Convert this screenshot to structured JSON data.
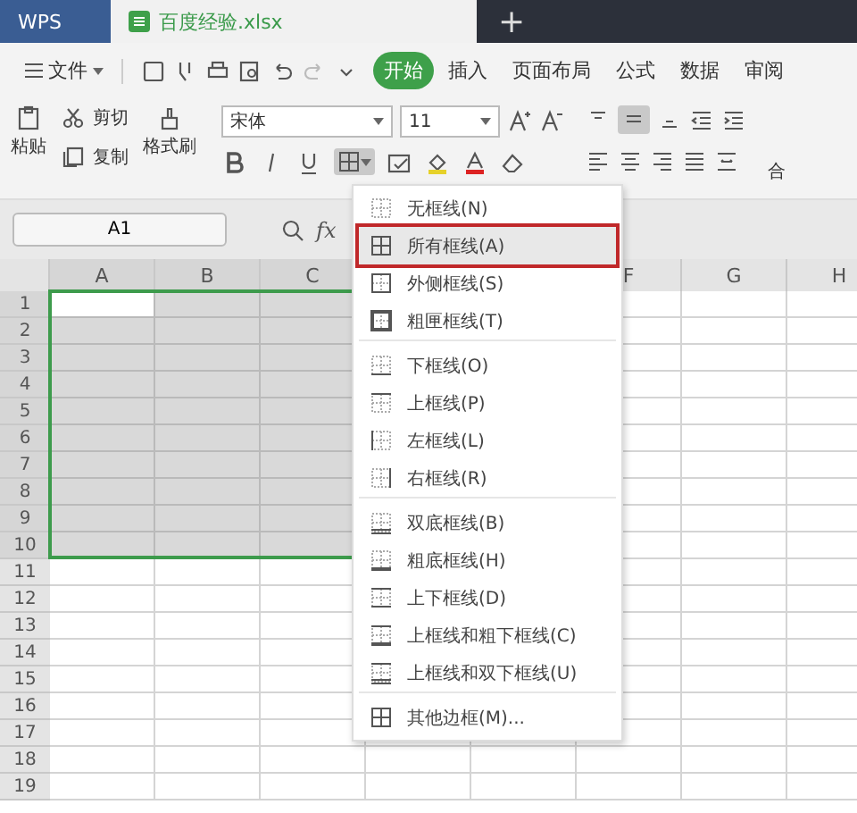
{
  "title_tabs": [
    {
      "label": "WPS",
      "kind": "app",
      "selected": false
    },
    {
      "label": "百度经验.xlsx",
      "kind": "file",
      "selected": true
    }
  ],
  "new_tab": "+",
  "menu": [
    {
      "label": "文件",
      "kind": "file",
      "selected": false
    },
    {
      "label": "开始",
      "kind": "tab",
      "selected": true
    },
    {
      "label": "插入",
      "kind": "tab",
      "selected": false
    },
    {
      "label": "页面布局",
      "kind": "tab",
      "selected": false
    },
    {
      "label": "公式",
      "kind": "tab",
      "selected": false
    },
    {
      "label": "数据",
      "kind": "tab",
      "selected": false
    },
    {
      "label": "审阅",
      "kind": "tab",
      "selected": false
    }
  ],
  "ribbon": {
    "paste": "粘贴",
    "cut": "剪切",
    "copy": "复制",
    "format_painter": "格式刷",
    "font": "宋体",
    "size": "11",
    "merge": "合"
  },
  "name_box": "A1",
  "fx": "fx",
  "columns": [
    {
      "label": "A",
      "selected": true
    },
    {
      "label": "B",
      "selected": true
    },
    {
      "label": "C",
      "selected": true
    },
    {},
    {},
    {
      "label": "F",
      "selected": false
    },
    {
      "label": "G",
      "selected": false
    },
    {
      "label": "H",
      "selected": false
    }
  ],
  "rows": [
    {
      "label": "1",
      "selected": true
    },
    {
      "label": "2",
      "selected": true
    },
    {
      "label": "3",
      "selected": true
    },
    {
      "label": "4",
      "selected": true
    },
    {
      "label": "5",
      "selected": true
    },
    {
      "label": "6",
      "selected": true
    },
    {
      "label": "7",
      "selected": true
    },
    {
      "label": "8",
      "selected": true
    },
    {
      "label": "9",
      "selected": true
    },
    {
      "label": "10",
      "selected": true
    },
    {
      "label": "11",
      "selected": false
    },
    {
      "label": "12",
      "selected": false
    },
    {
      "label": "13",
      "selected": false
    },
    {
      "label": "14",
      "selected": false
    },
    {
      "label": "15",
      "selected": false
    },
    {
      "label": "16",
      "selected": false
    },
    {
      "label": "17",
      "selected": false
    },
    {
      "label": "18",
      "selected": false
    },
    {
      "label": "19",
      "selected": false
    }
  ],
  "border_menu": [
    {
      "label": "无框线(N)",
      "kind": "none",
      "selected": false,
      "group_end": false
    },
    {
      "label": "所有框线(A)",
      "kind": "all",
      "selected": true,
      "group_end": false
    },
    {
      "label": "外侧框线(S)",
      "kind": "outside",
      "selected": false,
      "group_end": false
    },
    {
      "label": "粗匣框线(T)",
      "kind": "thick",
      "selected": false,
      "group_end": true
    },
    {
      "label": "下框线(O)",
      "kind": "bottom",
      "selected": false,
      "group_end": false
    },
    {
      "label": "上框线(P)",
      "kind": "top",
      "selected": false,
      "group_end": false
    },
    {
      "label": "左框线(L)",
      "kind": "left",
      "selected": false,
      "group_end": false
    },
    {
      "label": "右框线(R)",
      "kind": "right",
      "selected": false,
      "group_end": true
    },
    {
      "label": "双底框线(B)",
      "kind": "double-bottom",
      "selected": false,
      "group_end": false
    },
    {
      "label": "粗底框线(H)",
      "kind": "thick-bottom",
      "selected": false,
      "group_end": false
    },
    {
      "label": "上下框线(D)",
      "kind": "top-bottom",
      "selected": false,
      "group_end": false
    },
    {
      "label": "上框线和粗下框线(C)",
      "kind": "top-thick-bottom",
      "selected": false,
      "group_end": false
    },
    {
      "label": "上框线和双下框线(U)",
      "kind": "top-double-bottom",
      "selected": false,
      "group_end": true
    },
    {
      "label": "其他边框(M)...",
      "kind": "more",
      "selected": false,
      "group_end": false
    }
  ]
}
